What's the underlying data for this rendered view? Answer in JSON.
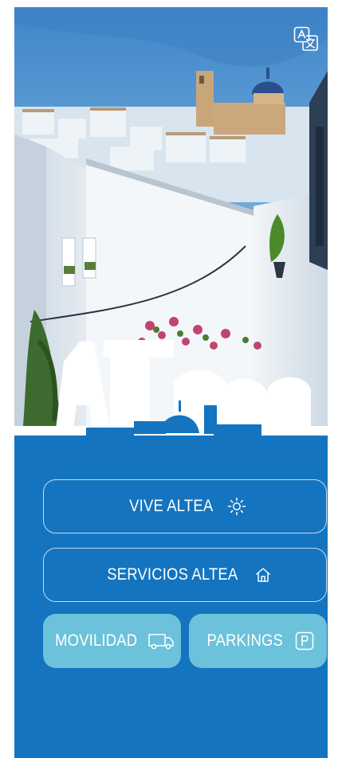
{
  "header": {
    "translate_icon": "translate-icon"
  },
  "brand": {
    "logo_text": "ALTEA",
    "logo_icon": "altea-logo"
  },
  "menu": {
    "vive": {
      "label": "VIVE ALTEA",
      "icon": "sun-icon"
    },
    "servicios": {
      "label": "SERVICIOS ALTEA",
      "icon": "home-icon"
    },
    "movilidad": {
      "label": "MOVILIDAD",
      "icon": "van-icon"
    },
    "parkings": {
      "label": "PARKINGS",
      "icon": "parking-icon"
    }
  },
  "colors": {
    "primary_blue": "#1474bf",
    "light_button": "#6cc2da",
    "text": "#ffffff"
  }
}
